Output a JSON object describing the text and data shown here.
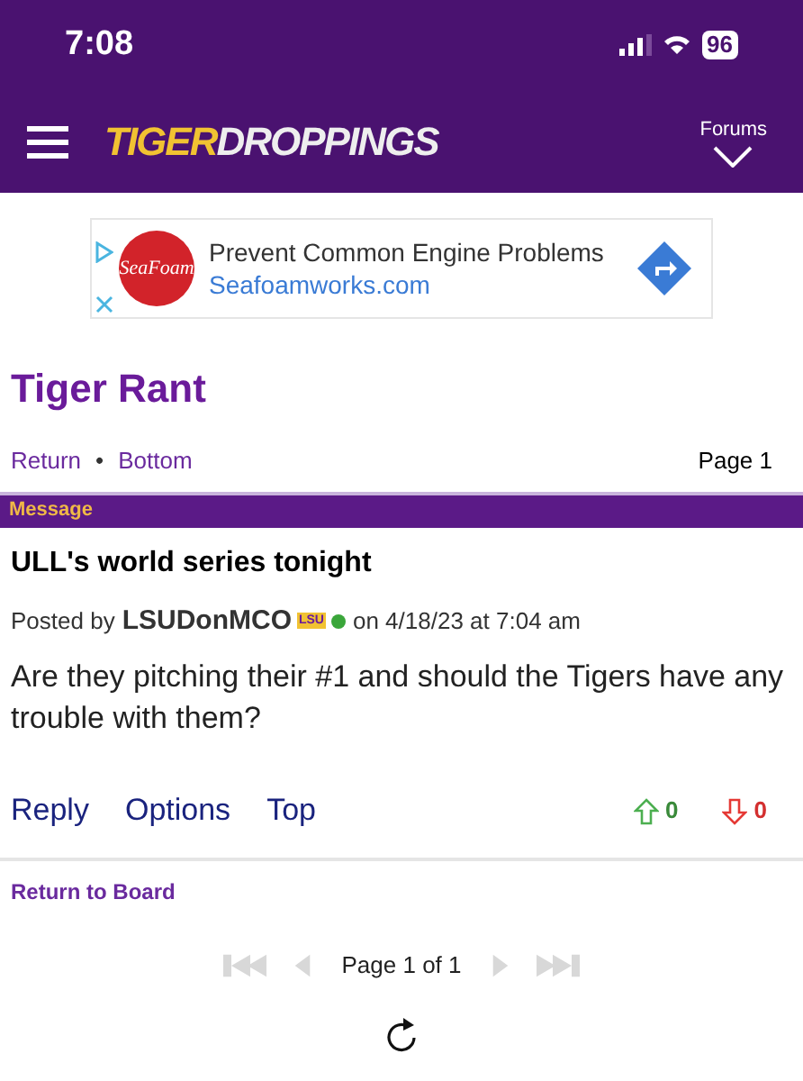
{
  "status_bar": {
    "time": "7:08",
    "battery": "96"
  },
  "header": {
    "logo_part_1": "TIGER",
    "logo_part_2": "DROPPINGS",
    "forums_label": "Forums"
  },
  "ad": {
    "brand_logo_text": "SeaFoam",
    "headline": "Prevent Common Engine Problems",
    "url": "Seafoamworks.com"
  },
  "board_title": "Tiger Rant",
  "nav": {
    "links": [
      "Return",
      "Bottom"
    ],
    "separator": "•",
    "page": "Page 1"
  },
  "message_bar": "Message",
  "post": {
    "title": "ULL's world series tonight",
    "posted_by": "Posted by",
    "author": "LSUDonMCO",
    "team_badge": "LSU",
    "date": "on 4/18/23 at 7:04 am",
    "body": "Are they pitching their #1 and should the Tigers have any trouble with them?",
    "actions": [
      "Reply",
      "Options",
      "Top"
    ],
    "upvotes": "0",
    "downvotes": "0"
  },
  "return_to_board": "Return to Board",
  "pager": {
    "label": "Page 1 of 1",
    "buttons": [
      {
        "kind": "first",
        "disabled": true
      },
      {
        "kind": "prev",
        "disabled": true
      },
      {
        "kind": "next",
        "disabled": true
      },
      {
        "kind": "last",
        "disabled": true
      }
    ]
  }
}
